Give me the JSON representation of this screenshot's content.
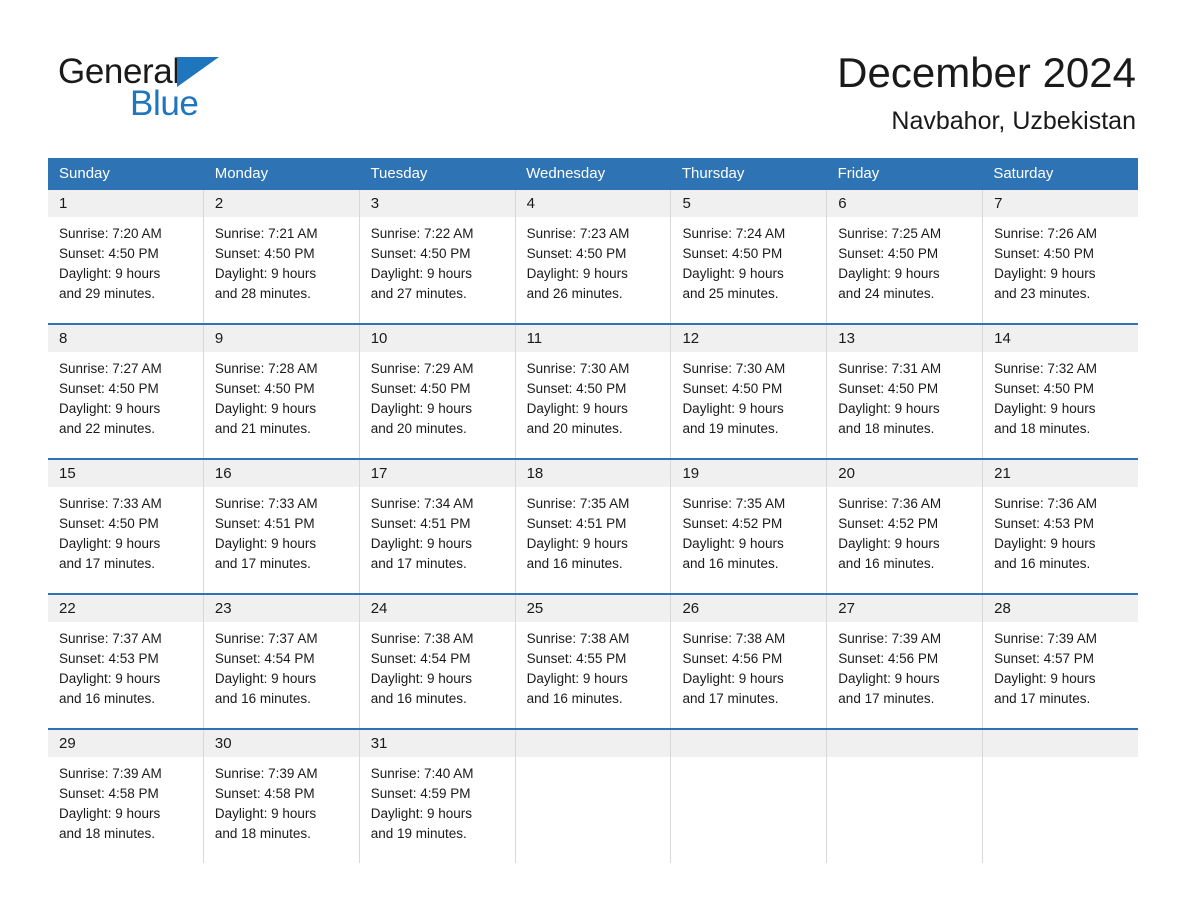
{
  "brand": {
    "name_part1": "General",
    "name_part2": "Blue",
    "triangle_icon": "blue-triangle-icon",
    "accent_color": "#1f76bc"
  },
  "header": {
    "title": "December 2024",
    "subtitle": "Navbahor, Uzbekistan",
    "header_bg_color": "#2e74b5",
    "daynum_bg_color": "#f0f0f0"
  },
  "weekdays": [
    "Sunday",
    "Monday",
    "Tuesday",
    "Wednesday",
    "Thursday",
    "Friday",
    "Saturday"
  ],
  "weeks": [
    [
      {
        "day": "1",
        "sunrise": "Sunrise: 7:20 AM",
        "sunset": "Sunset: 4:50 PM",
        "daylight_line1": "Daylight: 9 hours",
        "daylight_line2": "and 29 minutes."
      },
      {
        "day": "2",
        "sunrise": "Sunrise: 7:21 AM",
        "sunset": "Sunset: 4:50 PM",
        "daylight_line1": "Daylight: 9 hours",
        "daylight_line2": "and 28 minutes."
      },
      {
        "day": "3",
        "sunrise": "Sunrise: 7:22 AM",
        "sunset": "Sunset: 4:50 PM",
        "daylight_line1": "Daylight: 9 hours",
        "daylight_line2": "and 27 minutes."
      },
      {
        "day": "4",
        "sunrise": "Sunrise: 7:23 AM",
        "sunset": "Sunset: 4:50 PM",
        "daylight_line1": "Daylight: 9 hours",
        "daylight_line2": "and 26 minutes."
      },
      {
        "day": "5",
        "sunrise": "Sunrise: 7:24 AM",
        "sunset": "Sunset: 4:50 PM",
        "daylight_line1": "Daylight: 9 hours",
        "daylight_line2": "and 25 minutes."
      },
      {
        "day": "6",
        "sunrise": "Sunrise: 7:25 AM",
        "sunset": "Sunset: 4:50 PM",
        "daylight_line1": "Daylight: 9 hours",
        "daylight_line2": "and 24 minutes."
      },
      {
        "day": "7",
        "sunrise": "Sunrise: 7:26 AM",
        "sunset": "Sunset: 4:50 PM",
        "daylight_line1": "Daylight: 9 hours",
        "daylight_line2": "and 23 minutes."
      }
    ],
    [
      {
        "day": "8",
        "sunrise": "Sunrise: 7:27 AM",
        "sunset": "Sunset: 4:50 PM",
        "daylight_line1": "Daylight: 9 hours",
        "daylight_line2": "and 22 minutes."
      },
      {
        "day": "9",
        "sunrise": "Sunrise: 7:28 AM",
        "sunset": "Sunset: 4:50 PM",
        "daylight_line1": "Daylight: 9 hours",
        "daylight_line2": "and 21 minutes."
      },
      {
        "day": "10",
        "sunrise": "Sunrise: 7:29 AM",
        "sunset": "Sunset: 4:50 PM",
        "daylight_line1": "Daylight: 9 hours",
        "daylight_line2": "and 20 minutes."
      },
      {
        "day": "11",
        "sunrise": "Sunrise: 7:30 AM",
        "sunset": "Sunset: 4:50 PM",
        "daylight_line1": "Daylight: 9 hours",
        "daylight_line2": "and 20 minutes."
      },
      {
        "day": "12",
        "sunrise": "Sunrise: 7:30 AM",
        "sunset": "Sunset: 4:50 PM",
        "daylight_line1": "Daylight: 9 hours",
        "daylight_line2": "and 19 minutes."
      },
      {
        "day": "13",
        "sunrise": "Sunrise: 7:31 AM",
        "sunset": "Sunset: 4:50 PM",
        "daylight_line1": "Daylight: 9 hours",
        "daylight_line2": "and 18 minutes."
      },
      {
        "day": "14",
        "sunrise": "Sunrise: 7:32 AM",
        "sunset": "Sunset: 4:50 PM",
        "daylight_line1": "Daylight: 9 hours",
        "daylight_line2": "and 18 minutes."
      }
    ],
    [
      {
        "day": "15",
        "sunrise": "Sunrise: 7:33 AM",
        "sunset": "Sunset: 4:50 PM",
        "daylight_line1": "Daylight: 9 hours",
        "daylight_line2": "and 17 minutes."
      },
      {
        "day": "16",
        "sunrise": "Sunrise: 7:33 AM",
        "sunset": "Sunset: 4:51 PM",
        "daylight_line1": "Daylight: 9 hours",
        "daylight_line2": "and 17 minutes."
      },
      {
        "day": "17",
        "sunrise": "Sunrise: 7:34 AM",
        "sunset": "Sunset: 4:51 PM",
        "daylight_line1": "Daylight: 9 hours",
        "daylight_line2": "and 17 minutes."
      },
      {
        "day": "18",
        "sunrise": "Sunrise: 7:35 AM",
        "sunset": "Sunset: 4:51 PM",
        "daylight_line1": "Daylight: 9 hours",
        "daylight_line2": "and 16 minutes."
      },
      {
        "day": "19",
        "sunrise": "Sunrise: 7:35 AM",
        "sunset": "Sunset: 4:52 PM",
        "daylight_line1": "Daylight: 9 hours",
        "daylight_line2": "and 16 minutes."
      },
      {
        "day": "20",
        "sunrise": "Sunrise: 7:36 AM",
        "sunset": "Sunset: 4:52 PM",
        "daylight_line1": "Daylight: 9 hours",
        "daylight_line2": "and 16 minutes."
      },
      {
        "day": "21",
        "sunrise": "Sunrise: 7:36 AM",
        "sunset": "Sunset: 4:53 PM",
        "daylight_line1": "Daylight: 9 hours",
        "daylight_line2": "and 16 minutes."
      }
    ],
    [
      {
        "day": "22",
        "sunrise": "Sunrise: 7:37 AM",
        "sunset": "Sunset: 4:53 PM",
        "daylight_line1": "Daylight: 9 hours",
        "daylight_line2": "and 16 minutes."
      },
      {
        "day": "23",
        "sunrise": "Sunrise: 7:37 AM",
        "sunset": "Sunset: 4:54 PM",
        "daylight_line1": "Daylight: 9 hours",
        "daylight_line2": "and 16 minutes."
      },
      {
        "day": "24",
        "sunrise": "Sunrise: 7:38 AM",
        "sunset": "Sunset: 4:54 PM",
        "daylight_line1": "Daylight: 9 hours",
        "daylight_line2": "and 16 minutes."
      },
      {
        "day": "25",
        "sunrise": "Sunrise: 7:38 AM",
        "sunset": "Sunset: 4:55 PM",
        "daylight_line1": "Daylight: 9 hours",
        "daylight_line2": "and 16 minutes."
      },
      {
        "day": "26",
        "sunrise": "Sunrise: 7:38 AM",
        "sunset": "Sunset: 4:56 PM",
        "daylight_line1": "Daylight: 9 hours",
        "daylight_line2": "and 17 minutes."
      },
      {
        "day": "27",
        "sunrise": "Sunrise: 7:39 AM",
        "sunset": "Sunset: 4:56 PM",
        "daylight_line1": "Daylight: 9 hours",
        "daylight_line2": "and 17 minutes."
      },
      {
        "day": "28",
        "sunrise": "Sunrise: 7:39 AM",
        "sunset": "Sunset: 4:57 PM",
        "daylight_line1": "Daylight: 9 hours",
        "daylight_line2": "and 17 minutes."
      }
    ],
    [
      {
        "day": "29",
        "sunrise": "Sunrise: 7:39 AM",
        "sunset": "Sunset: 4:58 PM",
        "daylight_line1": "Daylight: 9 hours",
        "daylight_line2": "and 18 minutes."
      },
      {
        "day": "30",
        "sunrise": "Sunrise: 7:39 AM",
        "sunset": "Sunset: 4:58 PM",
        "daylight_line1": "Daylight: 9 hours",
        "daylight_line2": "and 18 minutes."
      },
      {
        "day": "31",
        "sunrise": "Sunrise: 7:40 AM",
        "sunset": "Sunset: 4:59 PM",
        "daylight_line1": "Daylight: 9 hours",
        "daylight_line2": "and 19 minutes."
      },
      {
        "day": "",
        "sunrise": "",
        "sunset": "",
        "daylight_line1": "",
        "daylight_line2": ""
      },
      {
        "day": "",
        "sunrise": "",
        "sunset": "",
        "daylight_line1": "",
        "daylight_line2": ""
      },
      {
        "day": "",
        "sunrise": "",
        "sunset": "",
        "daylight_line1": "",
        "daylight_line2": ""
      },
      {
        "day": "",
        "sunrise": "",
        "sunset": "",
        "daylight_line1": "",
        "daylight_line2": ""
      }
    ]
  ]
}
